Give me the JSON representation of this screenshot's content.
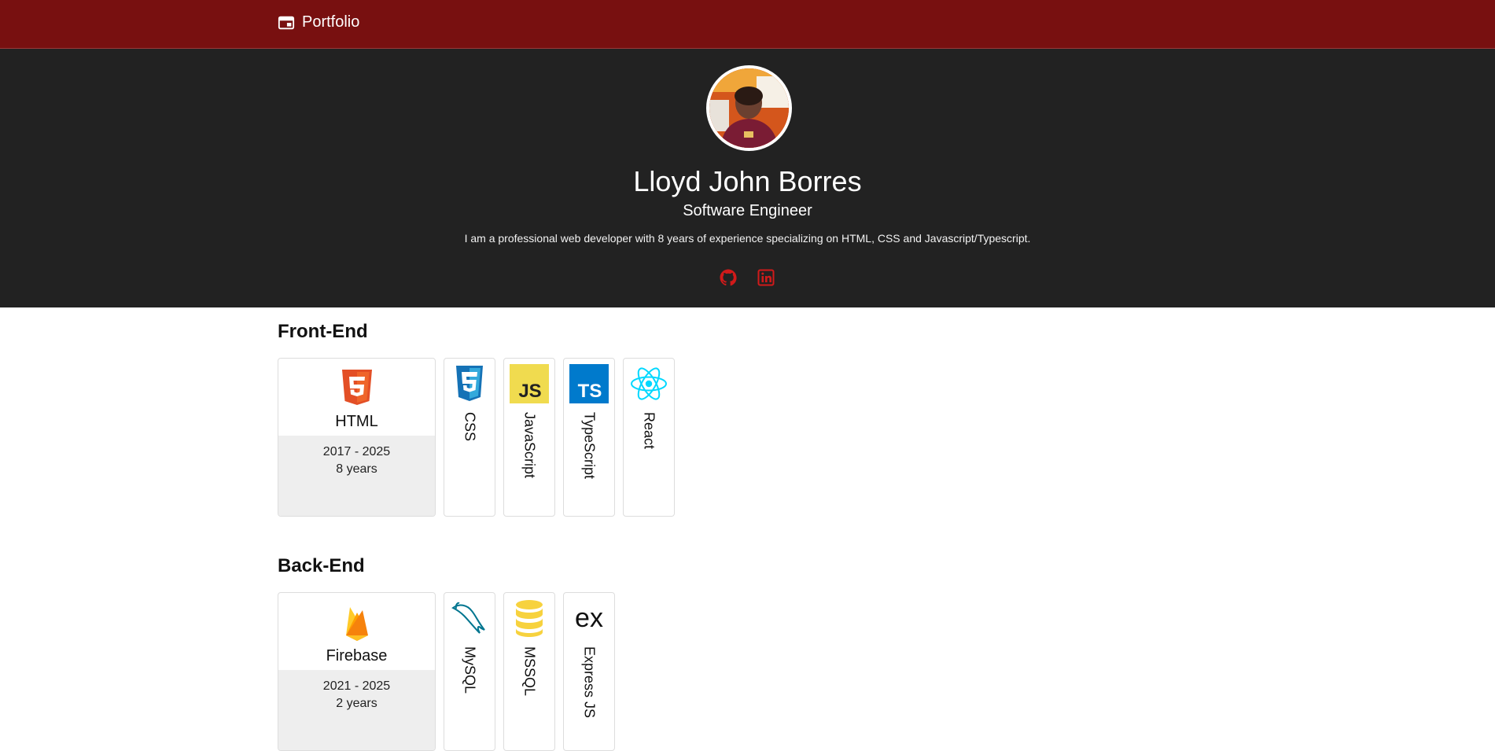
{
  "nav": {
    "brand": "Portfolio",
    "brand_icon": "browser-window-icon",
    "color": "#781010"
  },
  "hero": {
    "name": "Lloyd John Borres",
    "title": "Software Engineer",
    "bio": "I am a professional web developer with 8 years of experience specializing on HTML, CSS and Javascript/Typescript.",
    "social": [
      {
        "icon": "github-icon"
      },
      {
        "icon": "linkedin-icon"
      }
    ],
    "accent": "#d11a1a",
    "background": "#222222"
  },
  "sections": [
    {
      "title": "Front-End",
      "featured": {
        "name": "HTML",
        "years_range": "2017 - 2025",
        "duration": "8 years",
        "icon": "html5-icon"
      },
      "skills": [
        {
          "name": "CSS",
          "icon": "css3-icon"
        },
        {
          "name": "JavaScript",
          "icon": "javascript-icon"
        },
        {
          "name": "TypeScript",
          "icon": "typescript-icon"
        },
        {
          "name": "React",
          "icon": "react-icon"
        }
      ]
    },
    {
      "title": "Back-End",
      "featured": {
        "name": "Firebase",
        "years_range": "2021 - 2025",
        "duration": "2 years",
        "icon": "firebase-icon"
      },
      "skills": [
        {
          "name": "MySQL",
          "icon": "mysql-icon"
        },
        {
          "name": "MSSQL",
          "icon": "database-icon"
        },
        {
          "name": "Express JS",
          "icon": "express-icon"
        }
      ]
    }
  ]
}
